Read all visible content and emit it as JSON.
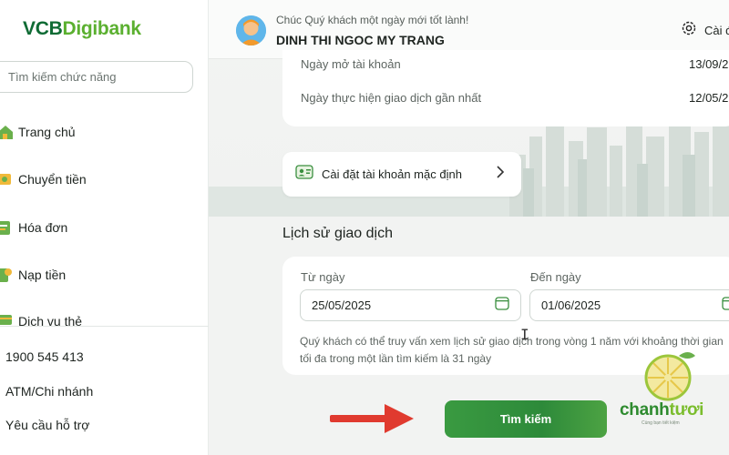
{
  "sidebar": {
    "logo_vcb": "VCB",
    "logo_digi": "Digibank",
    "search_placeholder": "Tìm kiếm chức năng",
    "items": [
      {
        "label": "Trang chủ"
      },
      {
        "label": "Chuyển tiền"
      },
      {
        "label": "Hóa đơn"
      },
      {
        "label": "Nạp tiền"
      },
      {
        "label": "Dịch vụ thẻ"
      }
    ],
    "hotline": "1900 545 413",
    "atm": "ATM/Chi nhánh",
    "support": "Yêu cầu hỗ trợ"
  },
  "header": {
    "greeting": "Chúc Quý khách một ngày mới tốt lành!",
    "username": "DINH THI NGOC MY TRANG",
    "settings_label": "Cài đ"
  },
  "account_info": {
    "rows": [
      {
        "label": "Ngày mở tài khoản",
        "value": "13/09/2"
      },
      {
        "label": "Ngày thực hiện giao dịch gần nhất",
        "value": "12/05/2"
      }
    ]
  },
  "default_account": {
    "label": "Cài đặt tài khoản mặc định"
  },
  "history": {
    "title": "Lịch sử giao dịch",
    "from_label": "Từ ngày",
    "from_value": "25/05/2025",
    "to_label": "Đến ngày",
    "to_value": "01/06/2025",
    "note": "Quý khách có thể truy vấn xem lịch sử giao dịch trong vòng 1 năm với khoảng thời gian tối đa trong một lần tìm kiếm là 31 ngày",
    "search_button": "Tìm kiếm"
  },
  "watermark": {
    "brand_a": "chanh",
    "brand_b": "tươi",
    "tagline": "Cùng bạn tiết kiệm"
  },
  "colors": {
    "brand_dark_green": "#0f6b34",
    "brand_light_green": "#5bb030",
    "button_green": "#2d8a3a",
    "arrow_red": "#e03a2f"
  }
}
